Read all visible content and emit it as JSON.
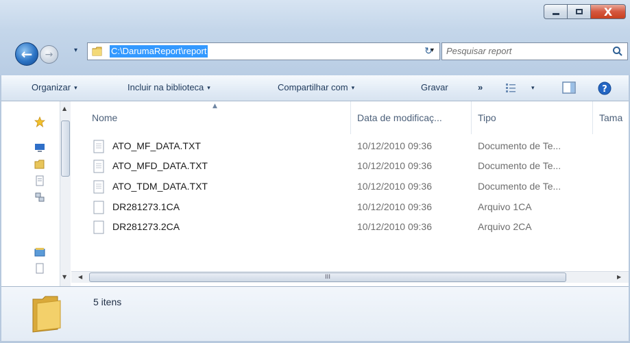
{
  "window": {
    "caption_buttons": {
      "minimize_icon": "minimize-icon",
      "maximize_icon": "maximize-icon",
      "close_label": "X"
    }
  },
  "navigation": {
    "back_glyph": "←",
    "forward_glyph": "→",
    "history_glyph": "▾"
  },
  "address_bar": {
    "path": "C:\\DarumaReport\\report",
    "dropdown_glyph": "▾",
    "refresh_glyph": "↻"
  },
  "search": {
    "placeholder": "Pesquisar report"
  },
  "toolbar": {
    "organize_label": "Organizar",
    "include_library_label": "Incluir na biblioteca",
    "share_label": "Compartilhar com",
    "burn_label": "Gravar",
    "more_glyph": "»",
    "caret_glyph": "▾"
  },
  "columns": {
    "name": "Nome",
    "date": "Data de modificaç...",
    "type": "Tipo",
    "size": "Tama"
  },
  "files": [
    {
      "name": "ATO_MF_DATA.TXT",
      "date": "10/12/2010 09:36",
      "type": "Documento de Te..."
    },
    {
      "name": "ATO_MFD_DATA.TXT",
      "date": "10/12/2010 09:36",
      "type": "Documento de Te..."
    },
    {
      "name": "ATO_TDM_DATA.TXT",
      "date": "10/12/2010 09:36",
      "type": "Documento de Te..."
    },
    {
      "name": "DR281273.1CA",
      "date": "10/12/2010 09:36",
      "type": "Arquivo 1CA"
    },
    {
      "name": "DR281273.2CA",
      "date": "10/12/2010 09:36",
      "type": "Arquivo 2CA"
    }
  ],
  "scrollbar": {
    "grip": "III",
    "left_arrow": "◀",
    "right_arrow": "▶",
    "up_arrow": "▲",
    "down_arrow": "▼"
  },
  "details_pane": {
    "item_count": "5 itens"
  },
  "colors": {
    "selection": "#3399ff",
    "chrome": "#c4d6ea",
    "close_button": "#d5573f"
  }
}
